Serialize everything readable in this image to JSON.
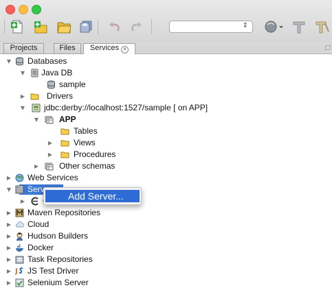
{
  "window": {
    "traffic_lights": [
      "#fc605c",
      "#fdbc40",
      "#34c84a"
    ],
    "toolbar_buttons": [
      "new-file-icon",
      "new-project-icon",
      "open-project-icon",
      "save-all-icon",
      "undo-icon",
      "redo-icon",
      "search-box",
      "profile-icon",
      "build-icon",
      "clean-build-icon"
    ]
  },
  "tabs": [
    {
      "label": "Projects",
      "active": false
    },
    {
      "label": "Files",
      "active": false
    },
    {
      "label": "Services",
      "active": true
    }
  ],
  "tree": {
    "databases": "Databases",
    "java_db": "Java DB",
    "sample": "sample",
    "drivers": "Drivers",
    "jdbc": "jdbc:derby://localhost:1527/sample [ on APP]",
    "app": "APP",
    "tables": "Tables",
    "views": "Views",
    "procedures": "Procedures",
    "other_schemas": "Other schemas",
    "web_services": "Web Services",
    "servers": "Servers",
    "glassfish_partial": "G",
    "maven": "Maven Repositories",
    "cloud": "Cloud",
    "hudson": "Hudson Builders",
    "docker": "Docker",
    "task_repos": "Task Repositories",
    "js_test": "JS Test Driver",
    "selenium": "Selenium Server"
  },
  "context_menu": {
    "add_server": "Add Server..."
  },
  "colors": {
    "selection": "#3b77d4",
    "menu_highlight": "#2e6bd6",
    "folder": "#f5cf4d"
  }
}
